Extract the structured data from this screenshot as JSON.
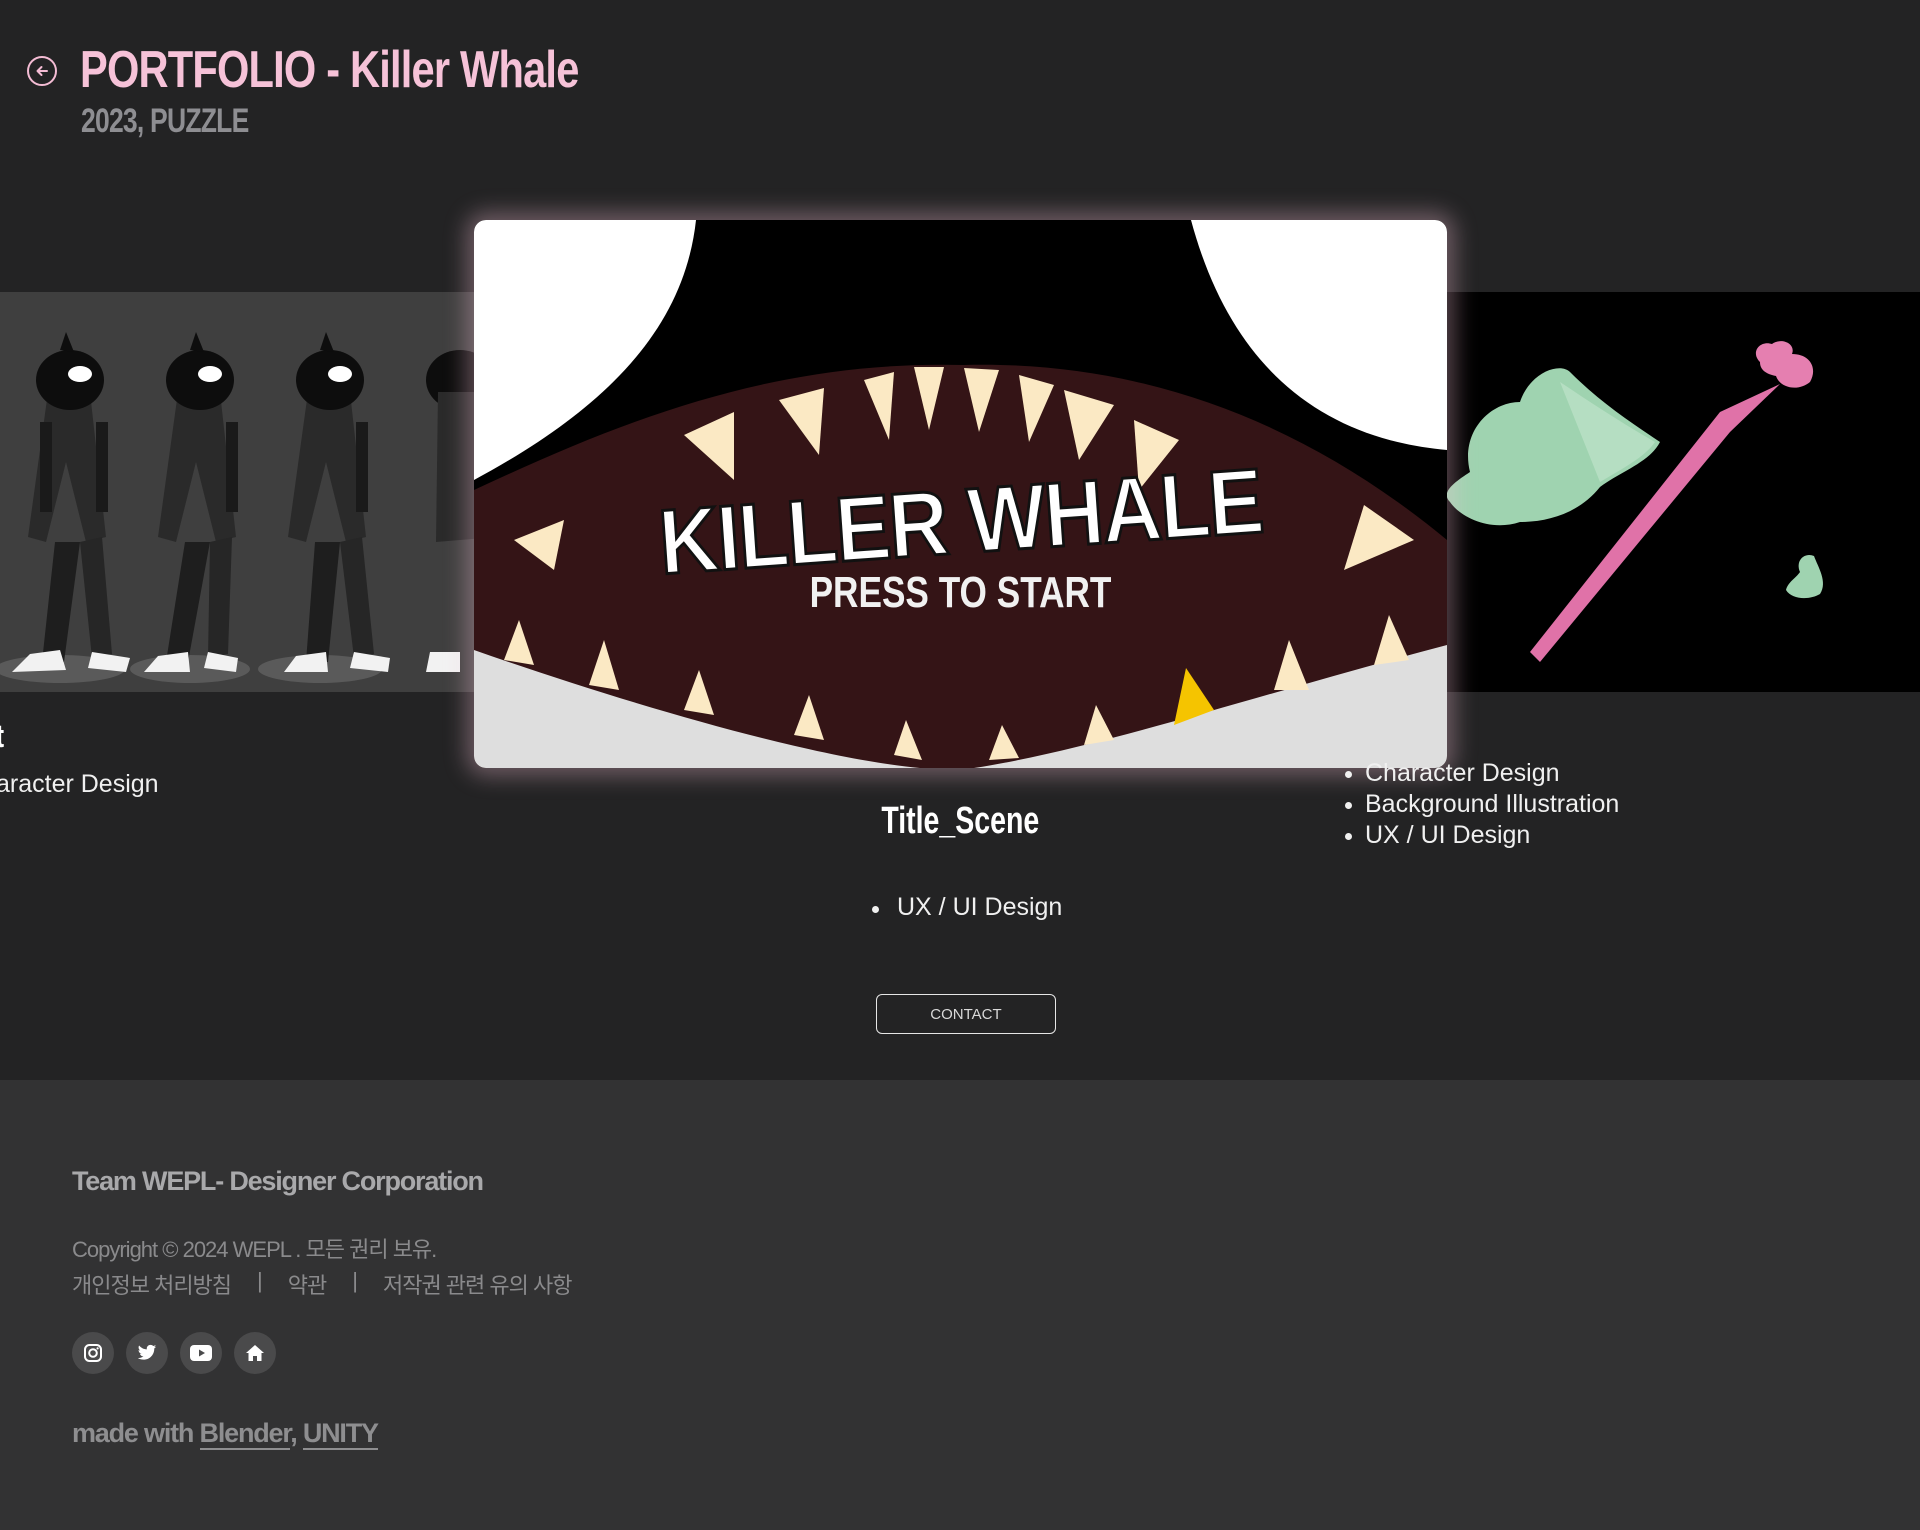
{
  "header": {
    "title": "PORTFOLIO - Killer Whale",
    "subtitle": "2023, PUZZLE",
    "back_icon": "arrow-left-circle-icon"
  },
  "carousel": {
    "left_slide": {
      "caption_title": "rt",
      "caption_item": "aracter Design"
    },
    "main_slide": {
      "game_title": "KILLER WHALE",
      "press_text": "PRESS TO START",
      "caption_title": "Title_Scene",
      "items": [
        "UX / UI Design"
      ]
    },
    "right_slide": {
      "items": [
        "Character Design",
        "Background Illustration",
        "UX / UI Design"
      ]
    }
  },
  "contact_label": "CONTACT",
  "footer": {
    "title": "Team WEPL- Designer Corporation",
    "copyright": "Copyright © 2024 WEPL . 모든 권리 보유.",
    "links": [
      "개인정보 처리방침",
      "약관",
      "저작권 관련 유의 사항"
    ],
    "separator": "|",
    "socials": [
      "instagram-icon",
      "twitter-icon",
      "youtube-icon",
      "home-icon"
    ],
    "made_with_prefix": "made with",
    "tools": [
      "Blender",
      "UNITY"
    ],
    "tools_separator": ","
  },
  "colors": {
    "accent_pink": "#f6c2d8",
    "background": "#232324",
    "footer_bg": "#323233"
  }
}
